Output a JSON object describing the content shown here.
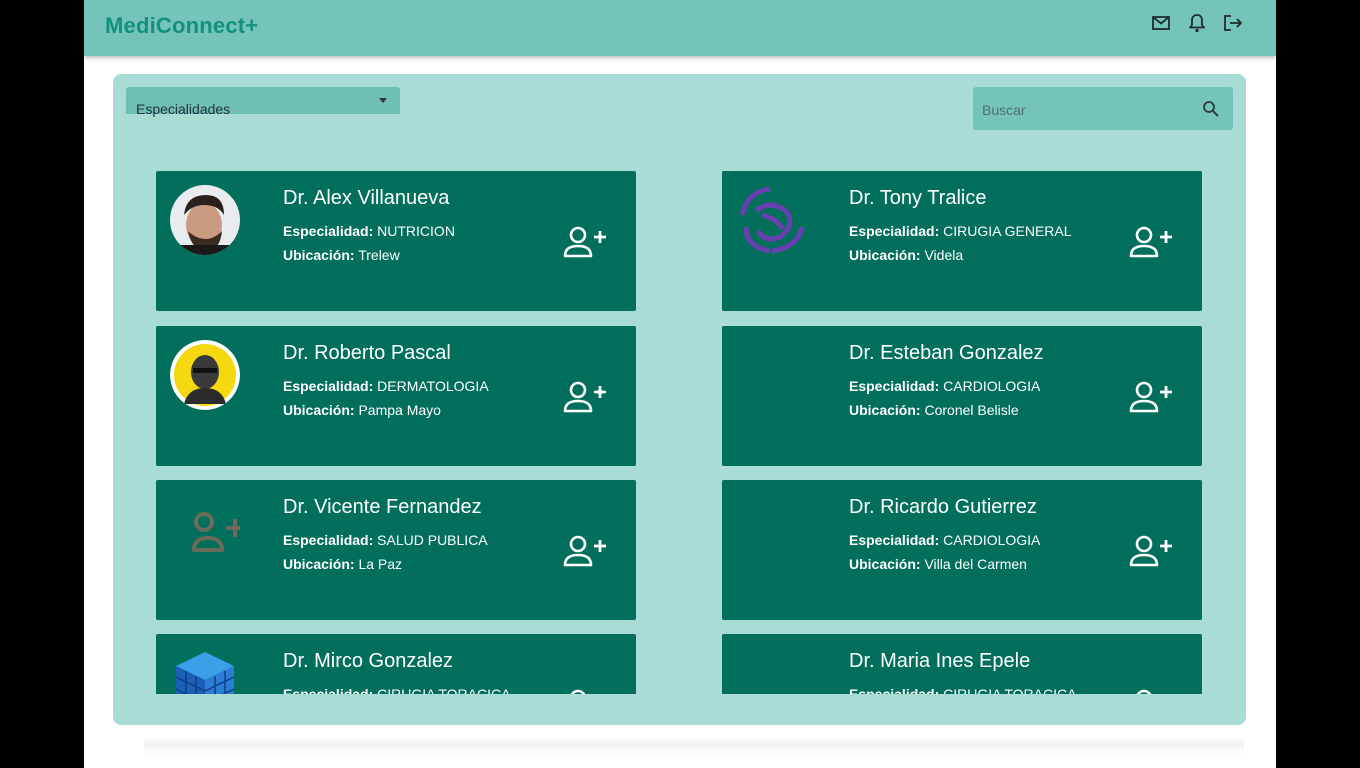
{
  "app": {
    "brand": "MediConnect+"
  },
  "header": {
    "icons": [
      "mail-icon",
      "bell-icon",
      "logout-icon"
    ]
  },
  "filters": {
    "specialty_select": "Especialidades",
    "search_placeholder": "Buscar"
  },
  "labels": {
    "specialty": "Especialidad:",
    "location": "Ubicación:"
  },
  "doctors": [
    {
      "name": "Dr. Alex Villanueva",
      "specialty": "NUTRICION",
      "location": "Trelew",
      "avatar": "photo-man-beard"
    },
    {
      "name": "Dr. Tony Tralice",
      "specialty": "CIRUGIA GENERAL",
      "location": "Videla",
      "avatar": "purple-knot-logo"
    },
    {
      "name": "Dr. Roberto Pascal",
      "specialty": "DERMATOLOGIA",
      "location": "Pampa Mayo",
      "avatar": "illustrated-man-yellow"
    },
    {
      "name": "Dr. Esteban Gonzalez",
      "specialty": "CARDIOLOGIA",
      "location": "Coronel Belisle",
      "avatar": "none"
    },
    {
      "name": "Dr. Vicente Fernandez",
      "specialty": "SALUD PUBLICA",
      "location": "La Paz",
      "avatar": "person-add-gray"
    },
    {
      "name": "Dr. Ricardo Gutierrez",
      "specialty": "CARDIOLOGIA",
      "location": "Villa del Carmen",
      "avatar": "none"
    },
    {
      "name": "Dr. Mirco Gonzalez",
      "specialty": "CIRUGIA TORACICA",
      "location": "",
      "avatar": "blue-cube"
    },
    {
      "name": "Dr. Maria Ines Epele",
      "specialty": "CIRUGIA TORACICA",
      "location": "",
      "avatar": "none"
    }
  ],
  "colors": {
    "header": "#74c4b9",
    "brand": "#14907e",
    "panel": "#a8dcd4",
    "card": "#026e5c"
  }
}
